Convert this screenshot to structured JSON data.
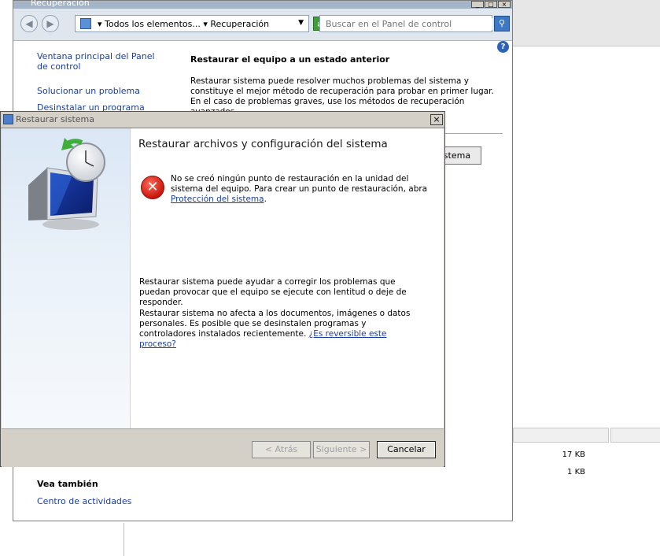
{
  "control_panel": {
    "title": "Recuperación",
    "address": "▾ Todos los elementos... ▾ Recuperación",
    "search_placeholder": "Buscar en el Panel de control",
    "help": "?",
    "left_links": [
      "Ventana principal del Panel de control",
      "Solucionar un problema",
      "Desinstalar un programa"
    ],
    "heading": "Restaurar el equipo a un estado anterior",
    "paragraph": "Restaurar sistema puede resolver muchos problemas del sistema y constituye el mejor método de recuperación para probar en primer lugar. En el caso de problemas graves, use los métodos de recuperación avanzados.",
    "open_restore_button": "r sistema",
    "see_also_heading": "Vea también",
    "see_also_links": [
      "Centro de actividades"
    ]
  },
  "background_explorer": {
    "file_sizes": [
      "17 KB",
      "1 KB"
    ]
  },
  "dialog": {
    "title": "Restaurar sistema",
    "close": "×",
    "heading": "Restaurar archivos y configuración del sistema",
    "error_text": "No se creó ningún punto de restauración en la unidad del sistema del equipo. Para crear un punto de restauración, abra",
    "error_link": "Protección del sistema",
    "info1": "Restaurar sistema puede ayudar a corregir los problemas que puedan provocar que el equipo se ejecute con lentitud o deje de responder.",
    "info2": "Restaurar sistema no afecta a los documentos, imágenes o datos personales. Es posible que se desinstalen programas y controladores instalados recientemente.",
    "info2_link": "¿Es reversible este proceso?",
    "buttons": {
      "back": "< Atrás",
      "next": "Siguiente >",
      "cancel": "Cancelar"
    }
  }
}
